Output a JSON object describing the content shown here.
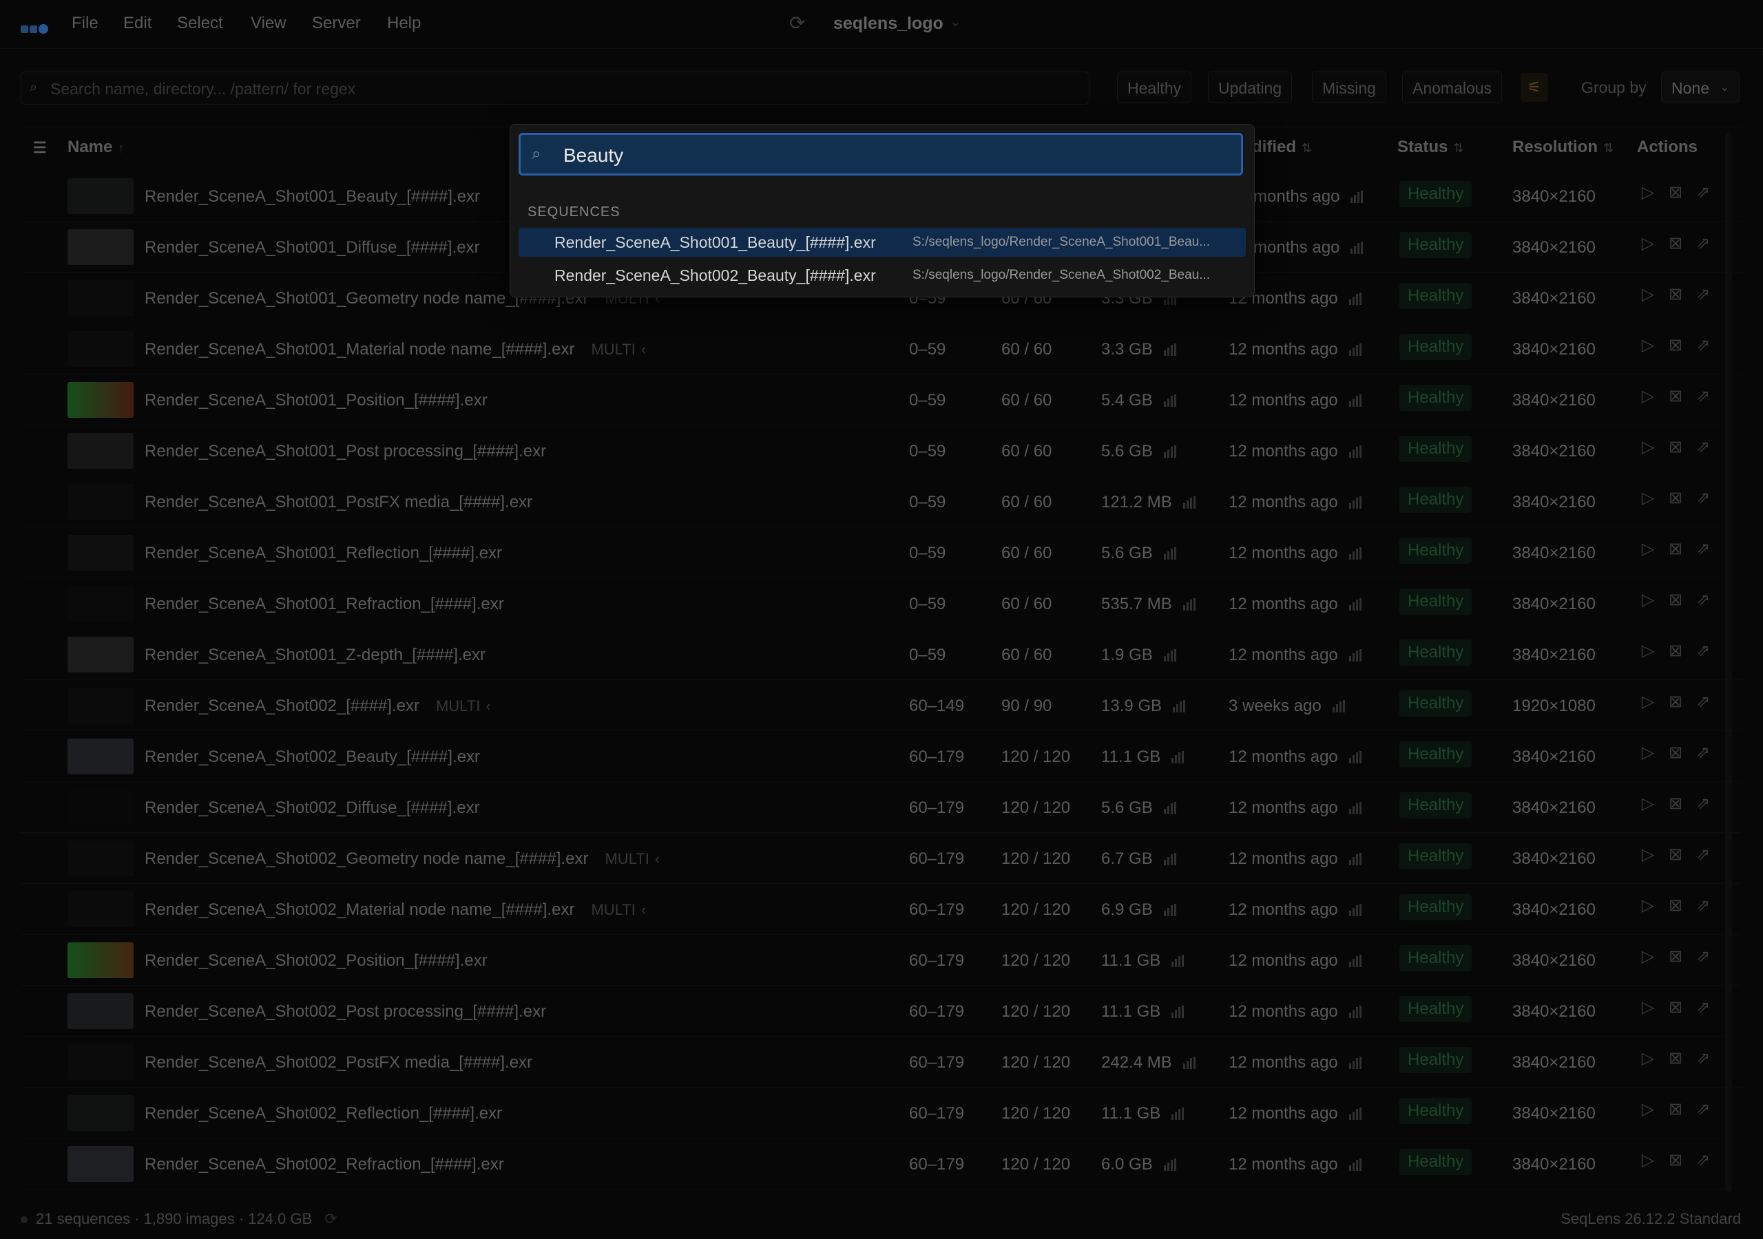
{
  "menubar": {
    "menus": [
      "File",
      "Edit",
      "Select",
      "View",
      "Server",
      "Help"
    ],
    "project_title": "seqlens_logo"
  },
  "filter_bar": {
    "search_placeholder": "Search name, directory... /pattern/ for regex",
    "status_filters": [
      "Healthy",
      "Updating",
      "Missing",
      "Anomalous"
    ],
    "group_by_label": "Group by",
    "group_by_value": "None"
  },
  "table": {
    "headers": {
      "name": "Name",
      "modified_partial": "dified",
      "status": "Status",
      "resolution": "Resolution",
      "actions": "Actions"
    },
    "rows": [
      {
        "name": "Render_SceneA_Shot001_Beauty_[####].exr",
        "multi": "",
        "range": "",
        "frames": "",
        "size": "",
        "modified": "months ago",
        "status": "Healthy",
        "resolution": "3840×2160"
      },
      {
        "name": "Render_SceneA_Shot001_Diffuse_[####].exr",
        "multi": "",
        "range": "",
        "frames": "",
        "size": "",
        "modified": "months ago",
        "status": "Healthy",
        "resolution": "3840×2160"
      },
      {
        "name": "Render_SceneA_Shot001_Geometry node name_[####].exr",
        "multi": "MULTI",
        "range": "0–59",
        "frames": "60 / 60",
        "size": "3.3 GB",
        "modified": "12 months ago",
        "status": "Healthy",
        "resolution": "3840×2160"
      },
      {
        "name": "Render_SceneA_Shot001_Material node name_[####].exr",
        "multi": "MULTI",
        "range": "0–59",
        "frames": "60 / 60",
        "size": "3.3 GB",
        "modified": "12 months ago",
        "status": "Healthy",
        "resolution": "3840×2160"
      },
      {
        "name": "Render_SceneA_Shot001_Position_[####].exr",
        "multi": "",
        "range": "0–59",
        "frames": "60 / 60",
        "size": "5.4 GB",
        "modified": "12 months ago",
        "status": "Healthy",
        "resolution": "3840×2160"
      },
      {
        "name": "Render_SceneA_Shot001_Post processing_[####].exr",
        "multi": "",
        "range": "0–59",
        "frames": "60 / 60",
        "size": "5.6 GB",
        "modified": "12 months ago",
        "status": "Healthy",
        "resolution": "3840×2160"
      },
      {
        "name": "Render_SceneA_Shot001_PostFX media_[####].exr",
        "multi": "",
        "range": "0–59",
        "frames": "60 / 60",
        "size": "121.2 MB",
        "modified": "12 months ago",
        "status": "Healthy",
        "resolution": "3840×2160"
      },
      {
        "name": "Render_SceneA_Shot001_Reflection_[####].exr",
        "multi": "",
        "range": "0–59",
        "frames": "60 / 60",
        "size": "5.6 GB",
        "modified": "12 months ago",
        "status": "Healthy",
        "resolution": "3840×2160"
      },
      {
        "name": "Render_SceneA_Shot001_Refraction_[####].exr",
        "multi": "",
        "range": "0–59",
        "frames": "60 / 60",
        "size": "535.7 MB",
        "modified": "12 months ago",
        "status": "Healthy",
        "resolution": "3840×2160"
      },
      {
        "name": "Render_SceneA_Shot001_Z-depth_[####].exr",
        "multi": "",
        "range": "0–59",
        "frames": "60 / 60",
        "size": "1.9 GB",
        "modified": "12 months ago",
        "status": "Healthy",
        "resolution": "3840×2160"
      },
      {
        "name": "Render_SceneA_Shot002_[####].exr",
        "multi": "MULTI",
        "range": "60–149",
        "frames": "90 / 90",
        "size": "13.9 GB",
        "modified": "3 weeks ago",
        "status": "Healthy",
        "resolution": "1920×1080"
      },
      {
        "name": "Render_SceneA_Shot002_Beauty_[####].exr",
        "multi": "",
        "range": "60–179",
        "frames": "120 / 120",
        "size": "11.1 GB",
        "modified": "12 months ago",
        "status": "Healthy",
        "resolution": "3840×2160"
      },
      {
        "name": "Render_SceneA_Shot002_Diffuse_[####].exr",
        "multi": "",
        "range": "60–179",
        "frames": "120 / 120",
        "size": "5.6 GB",
        "modified": "12 months ago",
        "status": "Healthy",
        "resolution": "3840×2160"
      },
      {
        "name": "Render_SceneA_Shot002_Geometry node name_[####].exr",
        "multi": "MULTI",
        "range": "60–179",
        "frames": "120 / 120",
        "size": "6.7 GB",
        "modified": "12 months ago",
        "status": "Healthy",
        "resolution": "3840×2160"
      },
      {
        "name": "Render_SceneA_Shot002_Material node name_[####].exr",
        "multi": "MULTI",
        "range": "60–179",
        "frames": "120 / 120",
        "size": "6.9 GB",
        "modified": "12 months ago",
        "status": "Healthy",
        "resolution": "3840×2160"
      },
      {
        "name": "Render_SceneA_Shot002_Position_[####].exr",
        "multi": "",
        "range": "60–179",
        "frames": "120 / 120",
        "size": "11.1 GB",
        "modified": "12 months ago",
        "status": "Healthy",
        "resolution": "3840×2160"
      },
      {
        "name": "Render_SceneA_Shot002_Post processing_[####].exr",
        "multi": "",
        "range": "60–179",
        "frames": "120 / 120",
        "size": "11.1 GB",
        "modified": "12 months ago",
        "status": "Healthy",
        "resolution": "3840×2160"
      },
      {
        "name": "Render_SceneA_Shot002_PostFX media_[####].exr",
        "multi": "",
        "range": "60–179",
        "frames": "120 / 120",
        "size": "242.4 MB",
        "modified": "12 months ago",
        "status": "Healthy",
        "resolution": "3840×2160"
      },
      {
        "name": "Render_SceneA_Shot002_Reflection_[####].exr",
        "multi": "",
        "range": "60–179",
        "frames": "120 / 120",
        "size": "11.1 GB",
        "modified": "12 months ago",
        "status": "Healthy",
        "resolution": "3840×2160"
      },
      {
        "name": "Render_SceneA_Shot002_Refraction_[####].exr",
        "multi": "",
        "range": "60–179",
        "frames": "120 / 120",
        "size": "6.0 GB",
        "modified": "12 months ago",
        "status": "Healthy",
        "resolution": "3840×2160"
      }
    ]
  },
  "footer": {
    "summary": "21 sequences · 1,890 images · 124.0 GB",
    "version": "SeqLens 26.12.2 Standard"
  },
  "palette": {
    "query": "Beauty",
    "section_label": "SEQUENCES",
    "results": [
      {
        "name": "Render_SceneA_Shot001_Beauty_[####].exr",
        "path": "S:/seqlens_logo/Render_SceneA_Shot001_Beau..."
      },
      {
        "name": "Render_SceneA_Shot002_Beauty_[####].exr",
        "path": "S:/seqlens_logo/Render_SceneA_Shot002_Beau..."
      }
    ]
  },
  "colors": {
    "background": "#0b0b0b",
    "accent": "#2c5ea8",
    "status_healthy": "#2e6b43"
  },
  "icons": [
    "refresh-icon",
    "search-icon",
    "filter-settings-icon",
    "column-settings-icon",
    "play-icon",
    "image-icon",
    "open-external-icon",
    "size-bars-icon"
  ]
}
